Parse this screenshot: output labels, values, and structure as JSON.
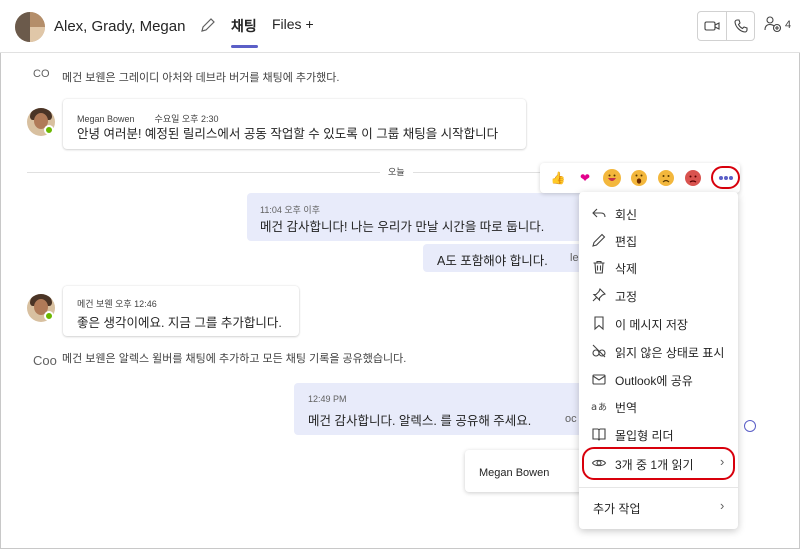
{
  "header": {
    "title": "Alex, Grady, Megan",
    "tabs": [
      {
        "label": "채팅"
      },
      {
        "label": "Files +"
      }
    ],
    "participant_count": "4"
  },
  "messages": {
    "system1": {
      "icon_text": "CO",
      "text": "메건 보웬은 그레이디 아처와 데브라 버거를 채팅에 추가했다."
    },
    "msg1": {
      "sender": "Megan Bowen",
      "time": "수요일 오후 2:30",
      "text": "안녕 여러분! 예정된 릴리스에서 공동 작업할 수 있도록 이 그룹 채팅을 시작합니다"
    },
    "day_divider": "오늘",
    "my1": {
      "time": "11:04 오후 이후",
      "text": "메건 감사합니다! 나는 우리가 만날 시간을 따로 둡니다."
    },
    "my2": {
      "text": "A도 포함해야 합니다.",
      "tail": "le"
    },
    "msg2": {
      "sender": "메건 보웬 오후 12:46",
      "text": "좋은 생각이에요. 지금 그를 추가합니다."
    },
    "system2": {
      "icon_text": "Coo",
      "text": "메건 보웬은 알렉스 윌버를 채팅에 추가하고 모든 채팅 기록을 공유했습니다."
    },
    "my3": {
      "time": "12:49 PM",
      "text": "메건 감사합니다. 알렉스. 를 공유해 주세요.",
      "tail": "oc"
    }
  },
  "reactions": [
    "like",
    "heart",
    "laugh",
    "surprised",
    "sad",
    "angry"
  ],
  "menu": {
    "items": [
      {
        "label": "회신",
        "icon": "reply-icon"
      },
      {
        "label": "편집",
        "icon": "edit-icon"
      },
      {
        "label": "삭제",
        "icon": "delete-icon"
      },
      {
        "label": "고정",
        "icon": "pin-icon"
      },
      {
        "label": "이 메시지 저장",
        "icon": "bookmark-icon"
      },
      {
        "label": "읽지 않은 상태로 표시",
        "icon": "unread-icon"
      },
      {
        "label": "Outlook에 공유",
        "icon": "mail-icon"
      },
      {
        "label": "번역",
        "icon": "translate-icon"
      },
      {
        "label": "몰입형 리더",
        "icon": "immersive-reader-icon"
      },
      {
        "label": "3개 중 1개 읽기",
        "icon": "eye-icon"
      },
      {
        "label": "추가 작업",
        "icon": ""
      }
    ]
  },
  "read_popover": {
    "name": "Megan Bowen"
  },
  "colors": {
    "accent": "#5b5fc7",
    "highlight": "#d8000c",
    "my_bubble": "#e8ebfa",
    "presence": "#6bb700"
  }
}
